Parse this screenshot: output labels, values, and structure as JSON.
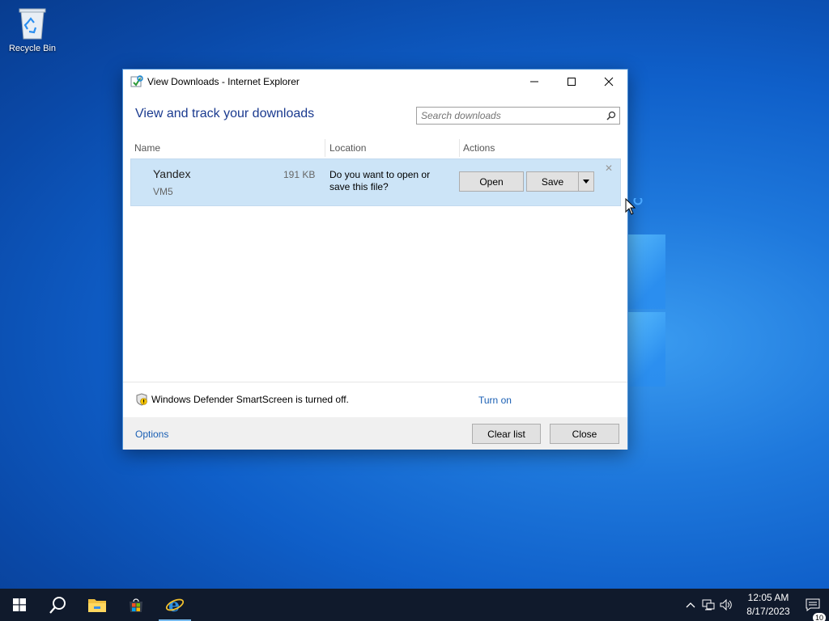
{
  "desktop": {
    "recycle_bin_label": "Recycle Bin"
  },
  "window": {
    "title": "View Downloads - Internet Explorer",
    "heading": "View and track your downloads",
    "search_placeholder": "Search downloads",
    "columns": {
      "name": "Name",
      "location": "Location",
      "actions": "Actions"
    },
    "download": {
      "name": "Yandex",
      "size": "191 KB",
      "source": "VM5",
      "message": "Do you want to open or save this file?",
      "open_label": "Open",
      "save_label": "Save"
    },
    "smartscreen_text": "Windows Defender SmartScreen is turned off.",
    "turn_on_label": "Turn on",
    "options_label": "Options",
    "clear_list_label": "Clear list",
    "close_label": "Close"
  },
  "taskbar": {
    "time": "12:05 AM",
    "date": "8/17/2023",
    "notification_count": "10"
  },
  "colors": {
    "accent": "#1a5fb4",
    "heading": "#1a3a8f",
    "selection": "#cce4f7",
    "taskbar": "#101a2c"
  }
}
